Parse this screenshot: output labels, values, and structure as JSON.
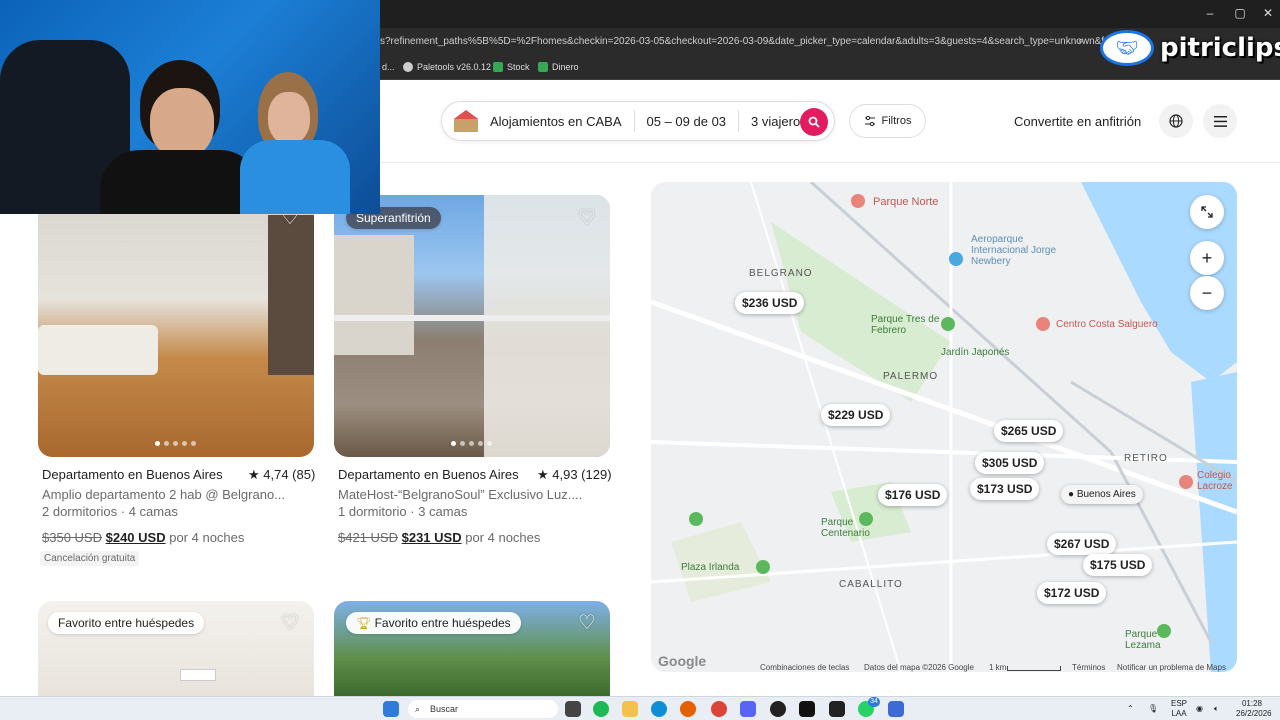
{
  "browser": {
    "url": "s?refinement_paths%5B%5D=%2Fhomes&checkin=2026-03-05&checkout=2026-03-09&date_picker_type=calendar&adults=3&guests=4&search_type=unknown&f...",
    "bookmarks": [
      {
        "label": "d...",
        "icon": "folder-icon"
      },
      {
        "label": "Paletools v26.0.12",
        "icon": "globe-icon"
      },
      {
        "label": "Stock",
        "icon": "plus-icon",
        "color": "#34a853"
      },
      {
        "label": "Dinero",
        "icon": "plus-icon",
        "color": "#34a853"
      }
    ],
    "window_controls": [
      "–",
      "▢",
      "✕"
    ]
  },
  "overlay_logo": "pitriclips",
  "header": {
    "location": "Alojamientos en CABA",
    "dates": "05 – 09 de 03",
    "guests": "3 viajeros",
    "filters": "Filtros",
    "host_link": "Convertite en anfitrión"
  },
  "listings": [
    {
      "title": "Departamento en Buenos Aires",
      "rating": "★ 4,74 (85)",
      "subtitle": "Amplio departamento 2 hab @ Belgrano...",
      "details": "2 dormitorios · 4 camas",
      "old_price": "$350 USD",
      "price": "$240 USD",
      "per": "por 4 noches",
      "cancel": "Cancelación gratuita"
    },
    {
      "badge": "Superanfitrión",
      "title": "Departamento en Buenos Aires",
      "rating": "★ 4,93 (129)",
      "subtitle": "MateHost-“BelgranoSoul” Exclusivo Luz....",
      "details": "1 dormitorio · 3 camas",
      "old_price": "$421 USD",
      "price": "$231 USD",
      "per": "por 4 noches"
    },
    {
      "badge": "Favorito entre huéspedes"
    },
    {
      "badge": "Favorito entre huéspedes"
    }
  ],
  "map": {
    "places": [
      "Parque Norte",
      "Aeroparque Internacional Jorge Newbery",
      "BELGRANO",
      "Parque Tres de Febrero",
      "Centro Costa Salguero",
      "Jardín Japonés",
      "PALERMO",
      "RETIRO",
      "Colegio Lacroze",
      "Parque Centenario",
      "Plaza Irlanda",
      "CABALLITO",
      "Parque Lezama",
      "Buenos Aires"
    ],
    "prices": [
      "$236 USD",
      "$229 USD",
      "$265 USD",
      "$305 USD",
      "$173 USD",
      "$176 USD",
      "$267 USD",
      "$175 USD",
      "$172 USD"
    ],
    "attribution": {
      "logo": "Google",
      "shortcuts": "Combinaciones de teclas",
      "data": "Datos del mapa ©2026 Google",
      "scale": "1 km",
      "terms": "Términos",
      "report": "Notificar un problema de Maps"
    }
  },
  "taskbar": {
    "search": "Buscar",
    "lang": "ESP\nLAA",
    "time": "01:28",
    "date": "26/2/2026",
    "whatsapp_badge": "34"
  }
}
